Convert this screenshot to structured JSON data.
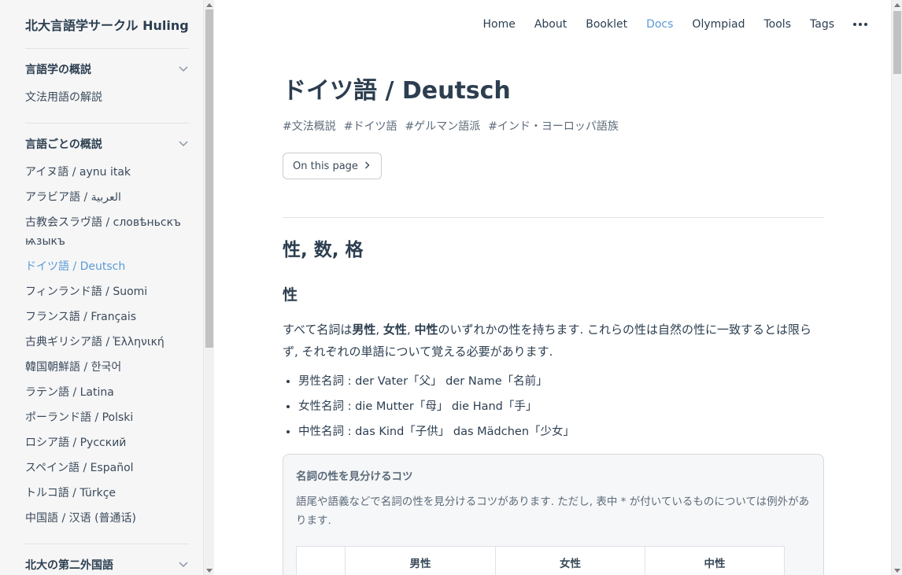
{
  "sidebar": {
    "brand": "北大言語学サークル Huling",
    "groups": [
      {
        "title": "言語学の概説",
        "items": [
          "文法用語の解説"
        ]
      },
      {
        "title": "言語ごとの概説",
        "items": [
          "アイヌ語 / aynu itak",
          "アラビア語 / العربية",
          "古教会スラヴ語 / словѣньскъ ѩзыкъ",
          "ドイツ語 / Deutsch",
          "フィンランド語 / Suomi",
          "フランス語 / Français",
          "古典ギリシア語 / Ἑλληνική",
          "韓国朝鮮語 / 한국어",
          "ラテン語 / Latina",
          "ポーランド語 / Polski",
          "ロシア語 / Русский",
          "スペイン語 / Español",
          "トルコ語 / Türkçe",
          "中国語 / 汉语 (普通话)"
        ],
        "active_index": 3
      },
      {
        "title": "北大の第二外国語",
        "items": []
      }
    ]
  },
  "nav": {
    "items": [
      "Home",
      "About",
      "Booklet",
      "Docs",
      "Olympiad",
      "Tools",
      "Tags"
    ],
    "active": "Docs"
  },
  "page": {
    "title": "ドイツ語 / Deutsch",
    "tags": [
      "#文法概説",
      "#ドイツ語",
      "#ゲルマン語派",
      "#インド・ヨーロッパ語族"
    ],
    "toc_button": "On this page"
  },
  "content": {
    "section_title": "性, 数, 格",
    "subsection_title": "性",
    "para_before": "すべて名詞は",
    "masc": "男性",
    "sep1": ", ",
    "fem": "女性",
    "sep2": ", ",
    "neut": "中性",
    "para_after": "のいずれかの性を持ちます. これらの性は自然の性に一致するとは限らず, それぞれの単語について覚える必要があります.",
    "list": [
      "男性名詞 : der Vater「父」 der Name「名前」",
      "女性名詞 : die Mutter「母」 die Hand「手」",
      "中性名詞 : das Kind「子供」 das Mädchen「少女」"
    ],
    "callout": {
      "title": "名詞の性を見分けるコツ",
      "text": "語尾や語義などで名詞の性を見分けるコツがあります. ただし, 表中 * が付いているものについては例外があります.",
      "table_headers": [
        "",
        "男性",
        "女性",
        "中性"
      ]
    }
  }
}
